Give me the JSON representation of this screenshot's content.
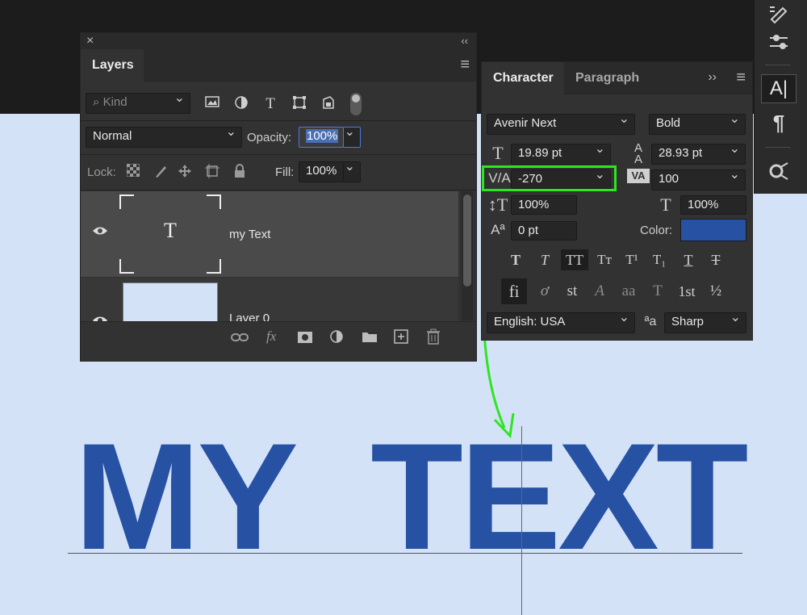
{
  "layers_panel": {
    "title": "Layers",
    "close_glyph": "×",
    "collapse_glyph": "‹‹",
    "menu_glyph": "≡",
    "kind_placeholder": "Kind",
    "blend_mode": "Normal",
    "opacity_label": "Opacity:",
    "opacity_value": "100%",
    "lock_label": "Lock:",
    "fill_label": "Fill:",
    "fill_value": "100%",
    "layers": [
      {
        "name": "my Text",
        "thumb_glyph": "T",
        "visible": true,
        "selected": true
      },
      {
        "name": "Layer 0",
        "visible": true,
        "selected": false
      }
    ],
    "footer_icons": [
      "link-icon",
      "fx-icon",
      "mask-icon",
      "adjustment-icon",
      "folder-icon",
      "new-layer-icon",
      "trash-icon"
    ]
  },
  "character_panel": {
    "tabs": [
      "Character",
      "Paragraph"
    ],
    "expand_glyph": "››",
    "menu_glyph": "≡",
    "font_family": "Avenir Next",
    "font_style": "Bold",
    "font_size": "19.89 pt",
    "leading": "28.93 pt",
    "kerning": "-270",
    "tracking": "100",
    "vertical_scale": "100%",
    "horizontal_scale": "100%",
    "baseline_shift": "0 pt",
    "color_label": "Color:",
    "text_color": "#2752a4",
    "type_style_buttons": [
      "T",
      "T",
      "TT",
      "Tт",
      "T¹",
      "T₁",
      "T",
      "T"
    ],
    "opentype_buttons": [
      "fi",
      "ơ",
      "st",
      "A",
      "aa",
      "T",
      "1st",
      "½"
    ],
    "language": "English: USA",
    "aa_icon_label": "ªa",
    "antialias": "Sharp"
  },
  "canvas": {
    "text": "MY  TEXT",
    "text_color": "#2752a4",
    "background": "#d4e2f8",
    "annotation_color": "#2ee620"
  }
}
